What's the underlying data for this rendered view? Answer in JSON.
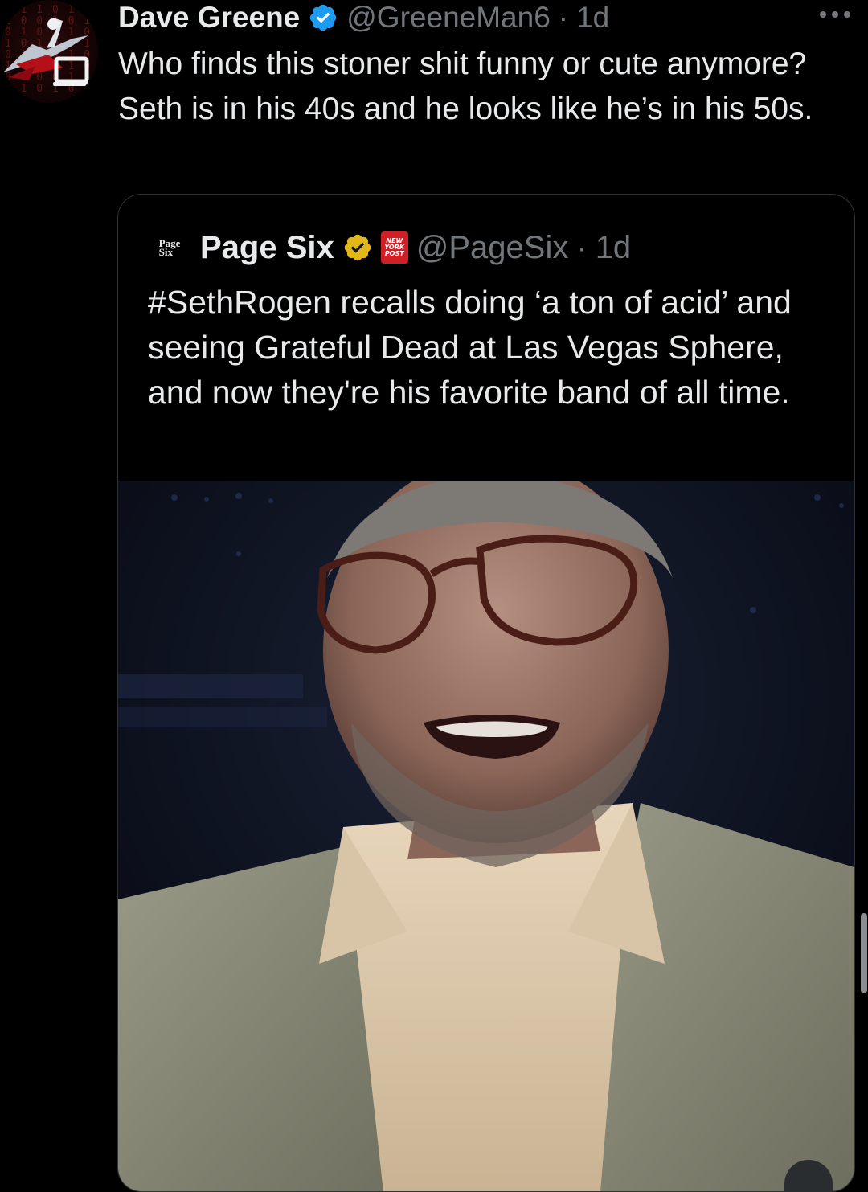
{
  "tweet": {
    "author": {
      "display_name": "Dave Greene",
      "handle": "@GreeneMan6",
      "separator": "·",
      "time": "1d",
      "verified": true
    },
    "text": "Who finds this stoner shit funny or cute anymore? Seth is in his 40s and he looks like he’s in his 50s.",
    "more_icon": "more-horizontal-icon"
  },
  "quoted": {
    "author": {
      "avatar_label": "Page Six",
      "display_name": "Page Six",
      "affiliate_badge": "NEW YORK POST",
      "handle": "@PageSix",
      "separator": "·",
      "time": "1d",
      "verified": true,
      "verified_color": "#e2b719"
    },
    "text": "#SethRogen recalls doing ‘a ton of acid’ and seeing Grateful Dead at Las Vegas Sphere, and now they're his favorite band of all time.",
    "media": "video-thumbnail"
  },
  "colors": {
    "background": "#000000",
    "primary_text": "#e7e9ea",
    "secondary_text": "#71767b",
    "border": "#2f3336",
    "verified_blue": "#1d9bf0",
    "verified_gold": "#e2b719",
    "nyp_red": "#d11f26"
  }
}
